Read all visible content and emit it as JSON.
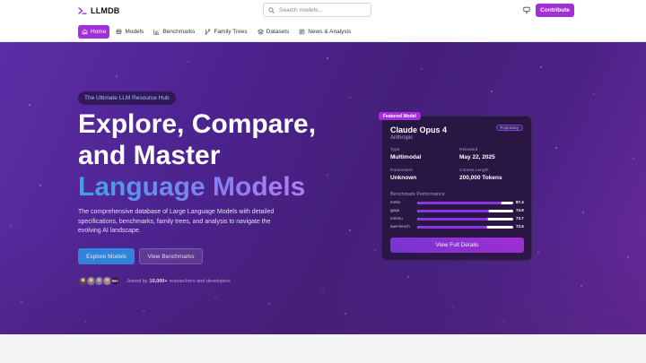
{
  "header": {
    "logo_text": "LLMDB",
    "search_placeholder": "Search models...",
    "contribute_label": "Contribute"
  },
  "nav": {
    "items": [
      {
        "label": "Home",
        "icon": "home-icon",
        "active": true
      },
      {
        "label": "Models",
        "icon": "database-icon",
        "active": false
      },
      {
        "label": "Benchmarks",
        "icon": "bar-chart-icon",
        "active": false
      },
      {
        "label": "Family Trees",
        "icon": "git-branch-icon",
        "active": false
      },
      {
        "label": "Datasets",
        "icon": "layers-icon",
        "active": false
      },
      {
        "label": "News & Analysis",
        "icon": "newspaper-icon",
        "active": false
      }
    ]
  },
  "hero": {
    "tagline": "The Ultimate LLM Resource Hub",
    "headline_line1": "Explore, Compare,",
    "headline_line2": "and Master",
    "headline_line3": "Language Models",
    "description": "The comprehensive database of Large Language Models with detailed specifications, benchmarks, family trees, and analysis to navigate the evolving AI landscape.",
    "explore_label": "Explore Models",
    "benchmarks_label": "View Benchmarks",
    "avatar_more": "99+",
    "joined_prefix": "Joined by",
    "joined_count": "10,000+",
    "joined_suffix": "researchers and developers"
  },
  "featured": {
    "badge": "Featured Model",
    "name": "Claude Opus 4",
    "provider": "Anthropic",
    "license_badge": "Proprietary",
    "type_label": "Type",
    "type_value": "Multimodal",
    "released_label": "Released",
    "released_value": "May 22, 2025",
    "params_label": "Parameters",
    "params_value": "Unknown",
    "context_label": "Context Length",
    "context_value": "200,000 Tokens",
    "benchmark_title": "Benchmark Performance",
    "benchmarks": [
      {
        "name": "mmlu",
        "value": 87.4,
        "display": "87.4"
      },
      {
        "name": "gpqa",
        "value": 74.9,
        "display": "74.9"
      },
      {
        "name": "mmmu",
        "value": 73.7,
        "display": "73.7"
      },
      {
        "name": "swe-bench",
        "value": 72.5,
        "display": "72.5"
      }
    ],
    "details_label": "View Full Details"
  },
  "colors": {
    "accent": "#a22fd8",
    "explore_button": "#2e8ee4",
    "hero_gradient_start": "#5c2ea6",
    "hero_gradient_end": "#6a2a9c"
  }
}
